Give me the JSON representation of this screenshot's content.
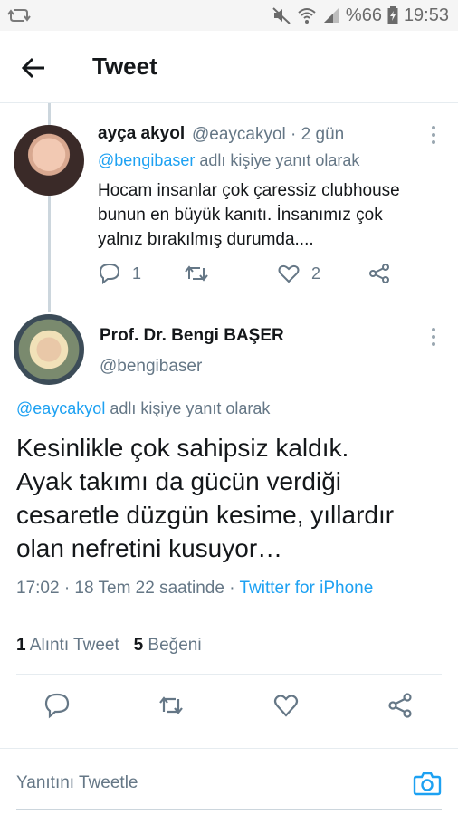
{
  "status_bar": {
    "battery": "%66",
    "time": "19:53"
  },
  "header": {
    "title": "Tweet"
  },
  "reply_tweet": {
    "name": "ayça akyol",
    "handle": "@eaycakyol · 2 gün",
    "reply_to_mention": "@bengibaser",
    "reply_to_suffix": " adlı kişiye yanıt olarak",
    "text_lines": [
      "Hocam insanlar çok çaressiz clubhouse",
      "bunun en büyük kanıtı. İnsanımız çok",
      "yalnız bırakılmış durumda...."
    ],
    "reply_count": "1",
    "like_count": "2"
  },
  "main_tweet": {
    "name": "Prof. Dr. Bengi BAŞER",
    "handle": "@bengibaser",
    "reply_to_mention": "@eaycakyol",
    "reply_to_suffix": " adlı kişiye yanıt olarak",
    "text_lines": [
      "Kesinlikle çok sahipsiz kaldık.",
      "Ayak takımı da gücün verdiği",
      "cesaretle düzgün kesime, yıllardır",
      "olan nefretini kusuyor…"
    ],
    "timestamp": "17:02 · 18 Tem 22 saatinde · ",
    "source": "Twitter for iPhone",
    "quote_count": "1",
    "quote_label": " Alıntı Tweet",
    "like_count": "5",
    "like_label": " Beğeni"
  },
  "reply_bar": {
    "placeholder": "Yanıtını Tweetle"
  },
  "colors": {
    "accent": "#1da1f2",
    "secondary_text": "#657786",
    "primary_text": "#14171a"
  }
}
